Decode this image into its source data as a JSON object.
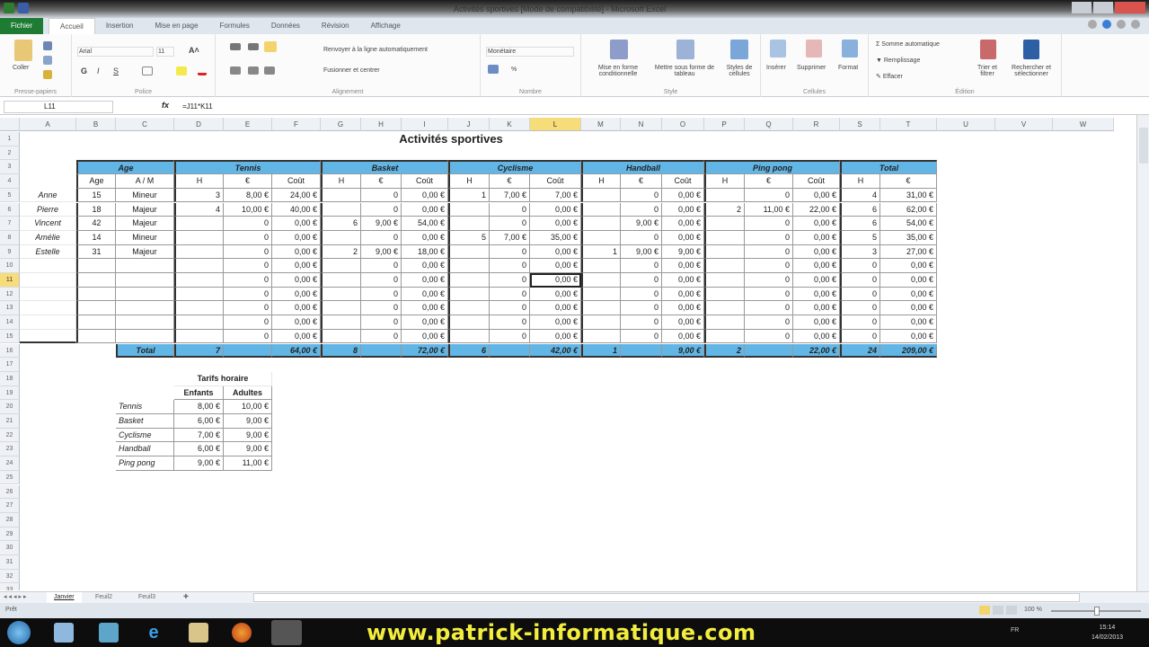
{
  "window": {
    "title": "Activités sportives [Mode de compatibilité] - Microsoft Excel"
  },
  "ribbon_tabs": [
    "Fichier",
    "Accueil",
    "Insertion",
    "Mise en page",
    "Formules",
    "Données",
    "Révision",
    "Affichage"
  ],
  "ribbon": {
    "paste": "Coller",
    "clipboard_group": "Presse-papiers",
    "font_name": "Arial",
    "font_size": "11",
    "font_group": "Police",
    "bold": "G",
    "italic": "I",
    "underline": "S",
    "wrap_text": "Renvoyer à la ligne automatiquement",
    "merge_center": "Fusionner et centrer",
    "alignment_group": "Alignement",
    "number_format": "Monétaire",
    "number_group": "Nombre",
    "cond_format": "Mise en forme conditionnelle",
    "table_format": "Mettre sous forme de tableau",
    "cell_styles": "Styles de cellules",
    "style_group": "Style",
    "insert": "Insérer",
    "delete": "Supprimer",
    "format": "Format",
    "cells_group": "Cellules",
    "autosum": "Somme automatique",
    "fill": "Remplissage",
    "clear": "Effacer",
    "sort_filter": "Trier et filtrer",
    "find_select": "Rechercher et sélectionner",
    "editing_group": "Édition"
  },
  "formula_bar": {
    "name_box": "L11",
    "fx": "fx",
    "formula": "=J11*K11"
  },
  "columns": [
    "A",
    "B",
    "C",
    "D",
    "E",
    "F",
    "G",
    "H",
    "I",
    "J",
    "K",
    "L",
    "M",
    "N",
    "O",
    "P",
    "Q",
    "R",
    "S",
    "T",
    "U",
    "V",
    "W"
  ],
  "row_count": 33,
  "selected": {
    "col": "L",
    "row": 11
  },
  "sheet": {
    "title": "Activités sportives",
    "groups": [
      {
        "label": "Age",
        "from": "B",
        "to": "C"
      },
      {
        "label": "Tennis",
        "from": "D",
        "to": "F"
      },
      {
        "label": "Basket",
        "from": "G",
        "to": "I"
      },
      {
        "label": "Cyclisme",
        "from": "J",
        "to": "L"
      },
      {
        "label": "Handball",
        "from": "M",
        "to": "O"
      },
      {
        "label": "Ping pong",
        "from": "P",
        "to": "R"
      },
      {
        "label": "Total",
        "from": "S",
        "to": "T"
      }
    ],
    "subheaders": [
      "Age",
      "A / M",
      "H",
      "€",
      "Coût",
      "H",
      "€",
      "Coût",
      "H",
      "€",
      "Coût",
      "H",
      "€",
      "Coût",
      "H",
      "€",
      "Coût",
      "H",
      "€"
    ],
    "rows": [
      [
        "Anne",
        "15",
        "Mineur",
        "3",
        "8,00 €",
        "24,00 €",
        "",
        "0",
        "0,00 €",
        "1",
        "7,00 €",
        "7,00 €",
        "",
        "0",
        "0,00 €",
        "",
        "0",
        "0,00 €",
        "4",
        "31,00 €"
      ],
      [
        "Pierre",
        "18",
        "Majeur",
        "4",
        "10,00 €",
        "40,00 €",
        "",
        "0",
        "0,00 €",
        "",
        "0",
        "0,00 €",
        "",
        "0",
        "0,00 €",
        "2",
        "11,00 €",
        "22,00 €",
        "6",
        "62,00 €"
      ],
      [
        "Vincent",
        "42",
        "Majeur",
        "",
        "0",
        "0,00 €",
        "6",
        "9,00 €",
        "54,00 €",
        "",
        "0",
        "0,00 €",
        "",
        "9,00 €",
        "0,00 €",
        "",
        "0",
        "0,00 €",
        "6",
        "54,00 €"
      ],
      [
        "Amélie",
        "14",
        "Mineur",
        "",
        "0",
        "0,00 €",
        "",
        "0",
        "0,00 €",
        "5",
        "7,00 €",
        "35,00 €",
        "",
        "0",
        "0,00 €",
        "",
        "0",
        "0,00 €",
        "5",
        "35,00 €"
      ],
      [
        "Estelle",
        "31",
        "Majeur",
        "",
        "0",
        "0,00 €",
        "2",
        "9,00 €",
        "18,00 €",
        "",
        "0",
        "0,00 €",
        "1",
        "9,00 €",
        "9,00 €",
        "",
        "0",
        "0,00 €",
        "3",
        "27,00 €"
      ],
      [
        "",
        "",
        "",
        "",
        "0",
        "0,00 €",
        "",
        "0",
        "0,00 €",
        "",
        "0",
        "0,00 €",
        "",
        "0",
        "0,00 €",
        "",
        "0",
        "0,00 €",
        "0",
        "0,00 €"
      ],
      [
        "",
        "",
        "",
        "",
        "0",
        "0,00 €",
        "",
        "0",
        "0,00 €",
        "",
        "0",
        "0,00 €",
        "",
        "0",
        "0,00 €",
        "",
        "0",
        "0,00 €",
        "0",
        "0,00 €"
      ],
      [
        "",
        "",
        "",
        "",
        "0",
        "0,00 €",
        "",
        "0",
        "0,00 €",
        "",
        "0",
        "0,00 €",
        "",
        "0",
        "0,00 €",
        "",
        "0",
        "0,00 €",
        "0",
        "0,00 €"
      ],
      [
        "",
        "",
        "",
        "",
        "0",
        "0,00 €",
        "",
        "0",
        "0,00 €",
        "",
        "0",
        "0,00 €",
        "",
        "0",
        "0,00 €",
        "",
        "0",
        "0,00 €",
        "0",
        "0,00 €"
      ],
      [
        "",
        "",
        "",
        "",
        "0",
        "0,00 €",
        "",
        "0",
        "0,00 €",
        "",
        "0",
        "0,00 €",
        "",
        "0",
        "0,00 €",
        "",
        "0",
        "0,00 €",
        "0",
        "0,00 €"
      ],
      [
        "",
        "",
        "",
        "",
        "0",
        "0,00 €",
        "",
        "0",
        "0,00 €",
        "",
        "0",
        "0,00 €",
        "",
        "0",
        "0,00 €",
        "",
        "0",
        "0,00 €",
        "0",
        "0,00 €"
      ]
    ],
    "total_row": [
      "",
      "",
      "Total",
      "7",
      "",
      "64,00 €",
      "8",
      "",
      "72,00 €",
      "6",
      "",
      "42,00 €",
      "1",
      "",
      "9,00 €",
      "2",
      "",
      "22,00 €",
      "24",
      "209,00 €"
    ],
    "rates": {
      "title": "Tarifs horaire",
      "headers": [
        "Enfants",
        "Adultes"
      ],
      "rows": [
        [
          "Tennis",
          "8,00 €",
          "10,00 €"
        ],
        [
          "Basket",
          "6,00 €",
          "9,00 €"
        ],
        [
          "Cyclisme",
          "7,00 €",
          "9,00 €"
        ],
        [
          "Handball",
          "6,00 €",
          "9,00 €"
        ],
        [
          "Ping pong",
          "9,00 €",
          "11,00 €"
        ]
      ]
    }
  },
  "sheet_tabs": [
    "Janvier",
    "Feuil2",
    "Feuil3"
  ],
  "status": {
    "ready": "Prêt",
    "zoom": "100 %"
  },
  "taskbar": {
    "watermark": "www.patrick-informatique.com",
    "lang": "FR",
    "time": "15:14",
    "date": "14/02/2013"
  },
  "colors": {
    "header_blue": "#62b6e6",
    "excel_green": "#1e7b34",
    "watermark": "#f3ee3d"
  }
}
